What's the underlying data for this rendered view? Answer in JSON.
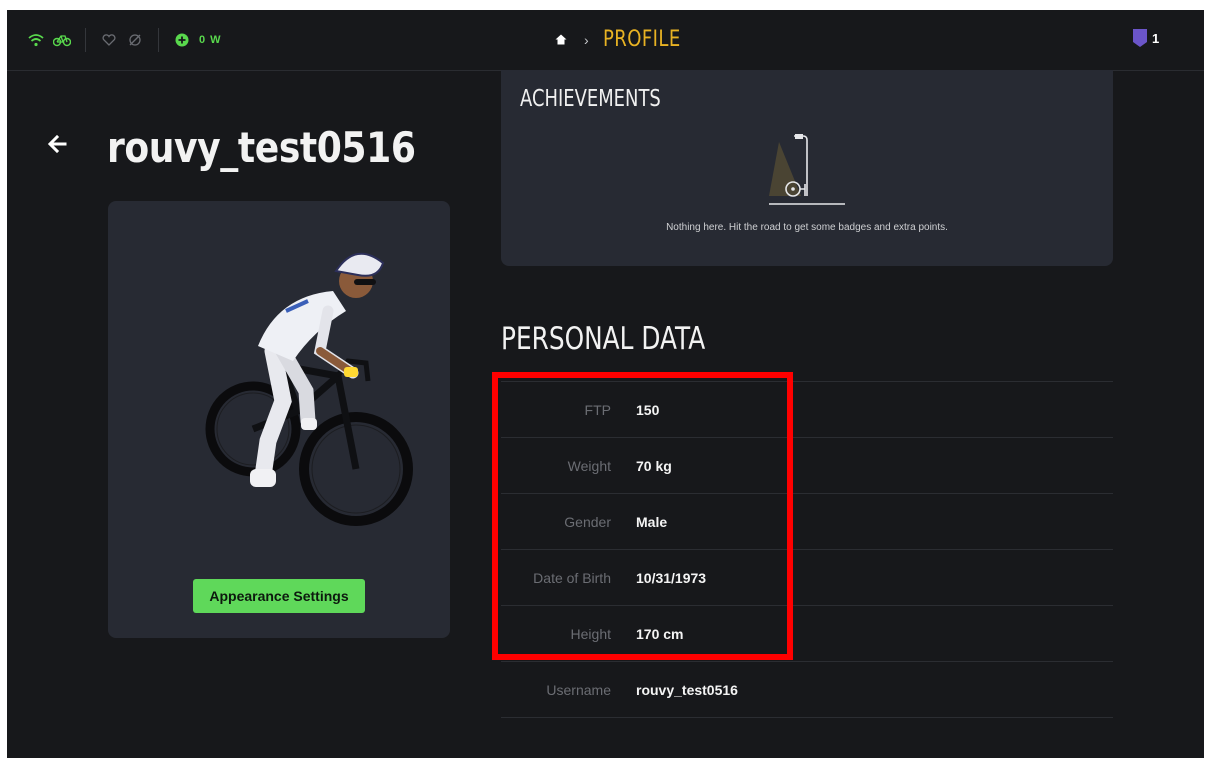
{
  "topbar": {
    "power": "0 W",
    "breadcrumb_title": "PROFILE",
    "badge_count": "1"
  },
  "profile": {
    "username": "rouvy_test0516",
    "appearance_button": "Appearance Settings"
  },
  "achievements": {
    "title": "ACHIEVEMENTS",
    "empty_message": "Nothing here. Hit the road to get some badges and extra points."
  },
  "personal_data": {
    "title": "PERSONAL DATA",
    "rows": [
      {
        "label": "FTP",
        "value": "150"
      },
      {
        "label": "Weight",
        "value": "70 kg"
      },
      {
        "label": "Gender",
        "value": "Male"
      },
      {
        "label": "Date of Birth",
        "value": "10/31/1973"
      },
      {
        "label": "Height",
        "value": "170 cm"
      },
      {
        "label": "Username",
        "value": "rouvy_test0516"
      }
    ]
  },
  "colors": {
    "background": "#17181b",
    "card": "#272a33",
    "accent_green": "#5fd85a",
    "accent_yellow": "#e8b223",
    "highlight_red": "#ff0000",
    "badge_purple": "#6b55c9"
  }
}
